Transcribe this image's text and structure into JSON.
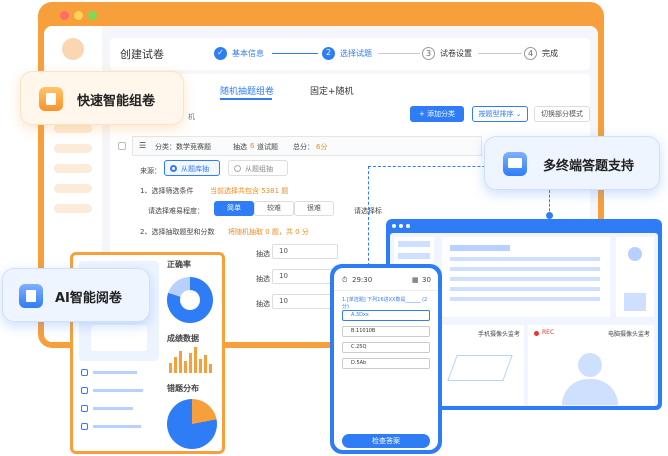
{
  "window": {
    "page_title": "创建试卷",
    "steps": [
      {
        "num": "1",
        "label": "基本信息",
        "state": "done"
      },
      {
        "num": "2",
        "label": "选择试题",
        "state": "active"
      },
      {
        "num": "3",
        "label": "试卷设置",
        "state": "todo"
      },
      {
        "num": "4",
        "label": "完成",
        "state": "todo"
      }
    ],
    "tabs": [
      "随机抽题组卷",
      "固定+随机"
    ],
    "partial_label": "机",
    "buttons": {
      "add_category": "+ 添加分类",
      "sort": "按题型排序 ⌄",
      "switch_mode": "切换部分模式"
    },
    "category": {
      "label": "分类：数学竞赛题",
      "pick": "抽选",
      "pick_count": "6",
      "pick_unit": "道试题",
      "total": "总分：",
      "total_value": "6分"
    },
    "source": {
      "label": "来源：",
      "opt1": "从题库抽",
      "opt2": "从题组抽"
    },
    "filter": {
      "label": "1、选择筛选条件",
      "note": "当前选择共包含 5381 题"
    },
    "difficulty": {
      "label": "请选择难易程度：",
      "options": [
        "简单",
        "较难",
        "很难"
      ],
      "right_label": "请选择标"
    },
    "pick_rule": {
      "label": "2、选择抽取题型和分数",
      "note": "将随机抽取 0 题，共 0 分"
    },
    "pick_rows": [
      {
        "label": "抽选",
        "value": "10"
      },
      {
        "label": "抽选",
        "value": "10"
      },
      {
        "label": "抽选",
        "value": "10"
      }
    ]
  },
  "badges": {
    "smart": "快速智能组卷",
    "multi": "多终端答题支持",
    "ai": "AI智能阅卷"
  },
  "ai_panel": {
    "accuracy": "正确率",
    "score_data": "成绩数据",
    "error_dist": "错题分布"
  },
  "phone": {
    "time": "29:30",
    "count": "30",
    "question": "1.[单选题] 下列16进XX数是______ (2分)",
    "options": [
      "A.3Dxx",
      "B.11010B",
      "C.25Q",
      "D.5Ab"
    ],
    "button": "检查答案"
  },
  "exam_screen": {
    "cam1": "手机摄像头监考",
    "rec": "REC",
    "cam2": "电脑摄像头监考"
  },
  "colors": {
    "orange": "#f7a03b",
    "blue": "#2f7df6"
  }
}
